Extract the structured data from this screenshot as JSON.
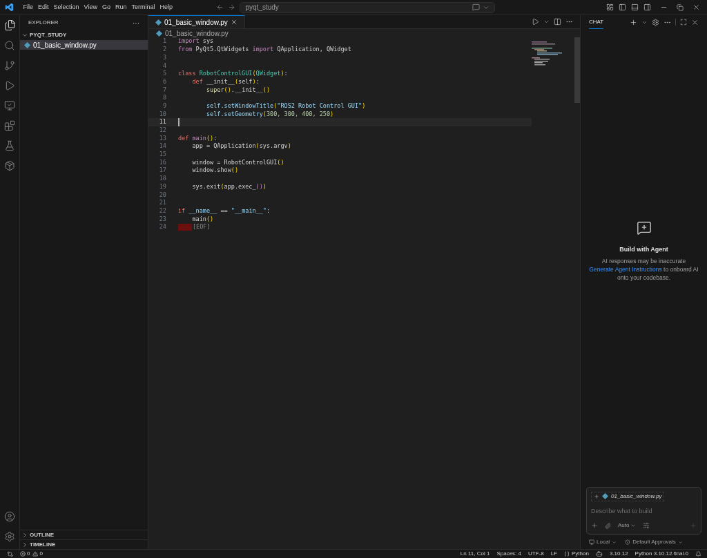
{
  "menu": [
    "File",
    "Edit",
    "Selection",
    "View",
    "Go",
    "Run",
    "Terminal",
    "Help"
  ],
  "command_center": {
    "value": "pyqt_study"
  },
  "sidebar": {
    "title": "EXPLORER",
    "more": "···",
    "folder": {
      "name": "PYQT_STUDY",
      "expanded": true,
      "children": [
        {
          "name": "01_basic_window.py",
          "selected": true
        }
      ]
    },
    "sections": [
      {
        "name": "OUTLINE",
        "expanded": false
      },
      {
        "name": "TIMELINE",
        "expanded": false
      }
    ]
  },
  "tabs": [
    {
      "label": "01_basic_window.py",
      "selected": true
    }
  ],
  "breadcrumb": "01_basic_window.py",
  "editor": {
    "lines": [
      {
        "n": "1",
        "current": false,
        "tokens": [
          {
            "kind": "kw",
            "text": "import"
          },
          {
            "kind": "tx",
            "text": " sys"
          }
        ]
      },
      {
        "n": "2",
        "current": false,
        "tokens": [
          {
            "kind": "kw",
            "text": "from"
          },
          {
            "kind": "tx",
            "text": " PyQt5.QtWidgets "
          },
          {
            "kind": "kw",
            "text": "import"
          },
          {
            "kind": "tx",
            "text": " QApplication, QWidget"
          }
        ]
      },
      {
        "n": "3",
        "current": false
      },
      {
        "n": "4",
        "current": false
      },
      {
        "n": "5",
        "current": false,
        "tokens": [
          {
            "kind": "st",
            "text": "class"
          },
          {
            "kind": "ty",
            "text": " RobotControlGUI"
          },
          {
            "kind": "pn",
            "text": "("
          },
          {
            "kind": "ty",
            "text": "QWidget"
          },
          {
            "kind": "pn",
            "text": ")"
          },
          {
            "kind": "tx",
            "text": ":"
          }
        ]
      },
      {
        "n": "6",
        "current": false,
        "tokens": [
          {
            "kind": "st",
            "text": "    def"
          },
          {
            "kind": "tx",
            "text": " __init__"
          },
          {
            "kind": "pn",
            "text": "("
          },
          {
            "kind": "tx",
            "text": "self"
          },
          {
            "kind": "pn",
            "text": ")"
          },
          {
            "kind": "tx",
            "text": ":"
          }
        ]
      },
      {
        "n": "7",
        "current": false,
        "tokens": [
          {
            "kind": "fn",
            "text": "        super"
          },
          {
            "kind": "pn",
            "text": "()"
          },
          {
            "kind": "tx",
            "text": ".__init__"
          },
          {
            "kind": "pn",
            "text": "()"
          }
        ]
      },
      {
        "n": "8",
        "current": false
      },
      {
        "n": "9",
        "current": false,
        "tokens": [
          {
            "kind": "sf",
            "text": "        self.setWindowTitle"
          },
          {
            "kind": "pn",
            "text": "("
          },
          {
            "kind": "sr",
            "text": "\"ROS2 Robot Control GUI\""
          },
          {
            "kind": "pn",
            "text": ")"
          }
        ]
      },
      {
        "n": "10",
        "current": false,
        "tokens": [
          {
            "kind": "sf",
            "text": "        self.setGeometry"
          },
          {
            "kind": "pn",
            "text": "("
          },
          {
            "kind": "nm",
            "text": "300, 300, 400, 250"
          },
          {
            "kind": "pn",
            "text": ")"
          }
        ]
      },
      {
        "n": "11",
        "current": true
      },
      {
        "n": "12",
        "current": false
      },
      {
        "n": "13",
        "current": false,
        "tokens": [
          {
            "kind": "st",
            "text": "def"
          },
          {
            "kind": "df",
            "text": " main"
          },
          {
            "kind": "pn",
            "text": "()"
          },
          {
            "kind": "tx",
            "text": ":"
          }
        ]
      },
      {
        "n": "14",
        "current": false,
        "tokens": [
          {
            "kind": "tx",
            "text": "    app = QApplication"
          },
          {
            "kind": "pn",
            "text": "("
          },
          {
            "kind": "tx",
            "text": "sys.argv"
          },
          {
            "kind": "pn",
            "text": ")"
          }
        ]
      },
      {
        "n": "15",
        "current": false
      },
      {
        "n": "16",
        "current": false,
        "tokens": [
          {
            "kind": "tx",
            "text": "    window = RobotControlGUI"
          },
          {
            "kind": "pn",
            "text": "()"
          }
        ]
      },
      {
        "n": "17",
        "current": false,
        "tokens": [
          {
            "kind": "tx",
            "text": "    window.show"
          },
          {
            "kind": "pn",
            "text": "()"
          }
        ]
      },
      {
        "n": "18",
        "current": false
      },
      {
        "n": "19",
        "current": false,
        "tokens": [
          {
            "kind": "tx",
            "text": "    sys.exit"
          },
          {
            "kind": "pn",
            "text": "("
          },
          {
            "kind": "tx",
            "text": "app.exec_"
          },
          {
            "kind": "df",
            "text": "()"
          },
          {
            "kind": "pn",
            "text": ")"
          }
        ]
      },
      {
        "n": "20",
        "current": false
      },
      {
        "n": "21",
        "current": false
      },
      {
        "n": "22",
        "current": false,
        "tokens": [
          {
            "kind": "st",
            "text": "if"
          },
          {
            "kind": "sf",
            "text": " __name__"
          },
          {
            "kind": "tx",
            "text": " == "
          },
          {
            "kind": "sr",
            "text": "\"__main__\""
          },
          {
            "kind": "tx",
            "text": ":"
          }
        ]
      },
      {
        "n": "23",
        "current": false,
        "tokens": [
          {
            "kind": "tx",
            "text": "    main"
          },
          {
            "kind": "pn",
            "text": "()"
          }
        ]
      },
      {
        "n": "24",
        "current": false,
        "tokens": [
          {
            "kind": "eof",
            "text": "[EOF]"
          }
        ]
      }
    ]
  },
  "chat": {
    "tab": {
      "label": "CHAT",
      "selected": true
    },
    "title": "Build with Agent",
    "note": "AI responses may be inaccurate",
    "link": "Generate Agent Instructions",
    "link_rest": "to onboard AI onto your codebase.",
    "attachment": "01_basic_window.py",
    "placeholder": "Describe what to build",
    "mode": "Auto",
    "location": "Local",
    "approvals": "Default Approvals"
  },
  "status_bar": {
    "errors": "0",
    "warnings": "0",
    "position": "Ln 11, Col 1",
    "indent": "Spaces: 4",
    "encoding": "UTF-8",
    "eol": "LF",
    "language": "Python",
    "version": "3.10.12",
    "interpreter": "Python 3.10.12.final.0"
  }
}
